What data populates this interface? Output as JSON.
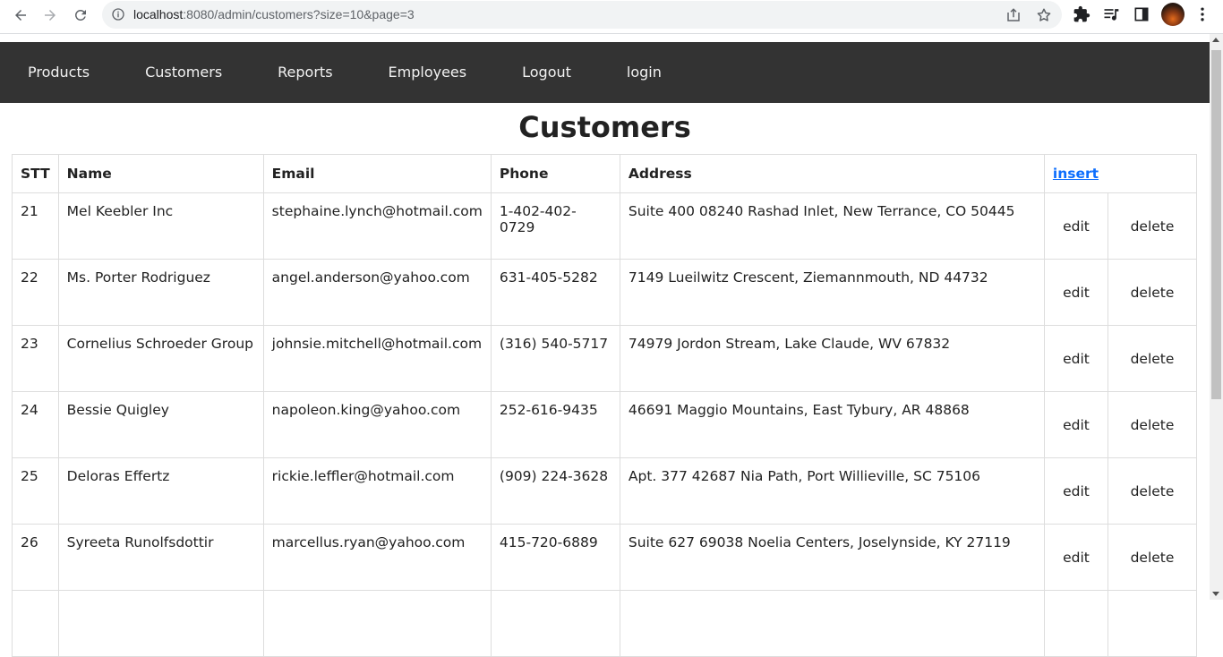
{
  "browser": {
    "url_host": "localhost",
    "url_rest": ":8080/admin/customers?size=10&page=3"
  },
  "nav": {
    "items": [
      "Products",
      "Customers",
      "Reports",
      "Employees",
      "Logout",
      "login"
    ]
  },
  "page": {
    "title": "Customers"
  },
  "table": {
    "headers": {
      "stt": "STT",
      "name": "Name",
      "email": "Email",
      "phone": "Phone",
      "address": "Address",
      "insert": "insert"
    },
    "rows": [
      {
        "stt": "21",
        "name": "Mel Keebler Inc",
        "email": "stephaine.lynch@hotmail.com",
        "phone": "1-402-402-0729",
        "address": "Suite 400 08240 Rashad Inlet, New Terrance, CO 50445",
        "edit": "edit",
        "delete": "delete"
      },
      {
        "stt": "22",
        "name": "Ms. Porter Rodriguez",
        "email": "angel.anderson@yahoo.com",
        "phone": "631-405-5282",
        "address": "7149 Lueilwitz Crescent, Ziemannmouth, ND 44732",
        "edit": "edit",
        "delete": "delete"
      },
      {
        "stt": "23",
        "name": "Cornelius Schroeder Group",
        "email": "johnsie.mitchell@hotmail.com",
        "phone": "(316) 540-5717",
        "address": "74979 Jordon Stream, Lake Claude, WV 67832",
        "edit": "edit",
        "delete": "delete"
      },
      {
        "stt": "24",
        "name": "Bessie Quigley",
        "email": "napoleon.king@yahoo.com",
        "phone": "252-616-9435",
        "address": "46691 Maggio Mountains, East Tybury, AR 48868",
        "edit": "edit",
        "delete": "delete"
      },
      {
        "stt": "25",
        "name": "Deloras Effertz",
        "email": "rickie.leffler@hotmail.com",
        "phone": "(909) 224-3628",
        "address": "Apt. 377 42687 Nia Path, Port Willieville, SC 75106",
        "edit": "edit",
        "delete": "delete"
      },
      {
        "stt": "26",
        "name": "Syreeta Runolfsdottir",
        "email": "marcellus.ryan@yahoo.com",
        "phone": "415-720-6889",
        "address": "Suite 627 69038 Noelia Centers, Joselynside, KY 27119",
        "edit": "edit",
        "delete": "delete"
      },
      {
        "stt": "",
        "name": "",
        "email": "",
        "phone": "",
        "address": "",
        "edit": "",
        "delete": ""
      }
    ]
  }
}
